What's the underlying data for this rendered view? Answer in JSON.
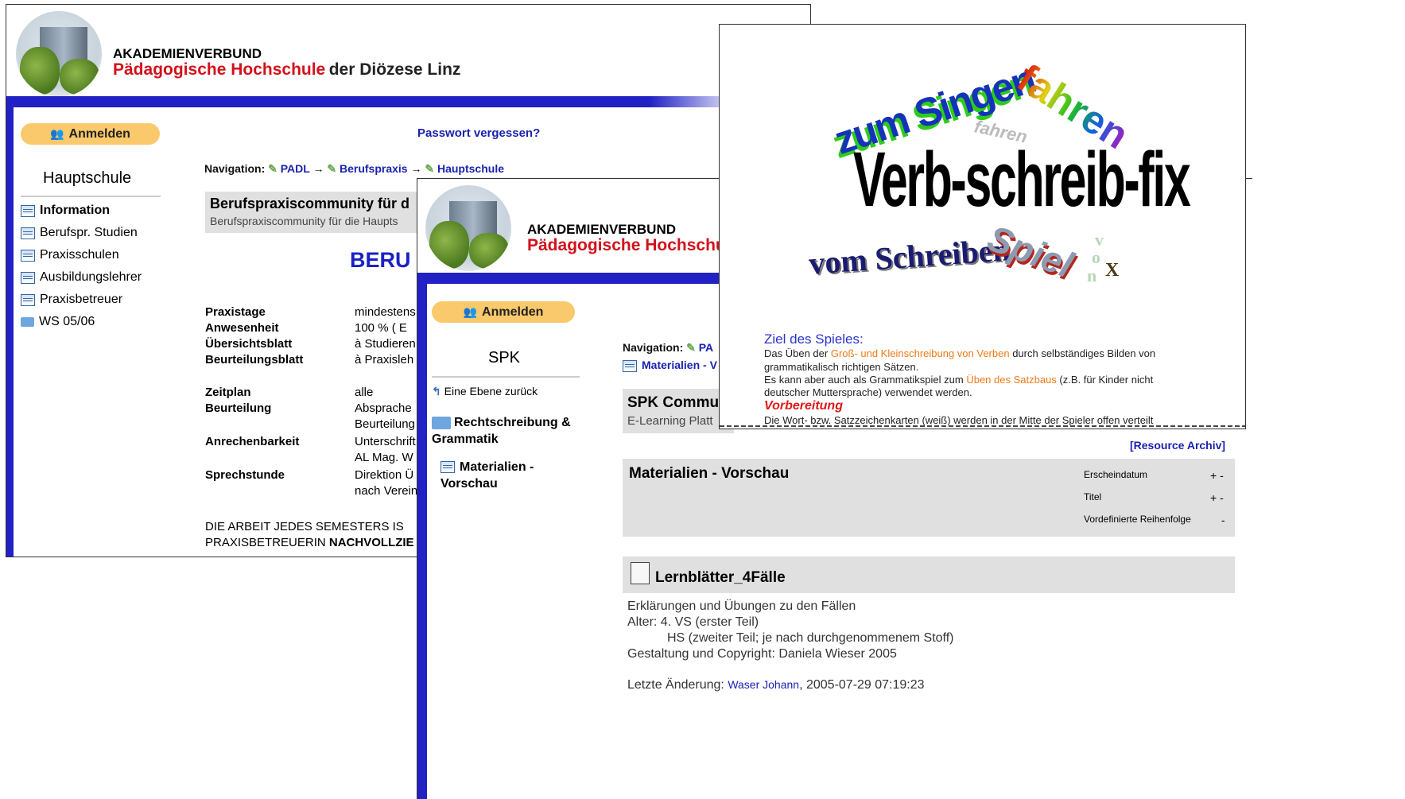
{
  "window1": {
    "banner": {
      "line1": "AKADEMIENVERBUND",
      "line2_red": "Pädagogische Hochschule",
      "line2_dark": "der Diözese Linz"
    },
    "login_label": "Anmelden",
    "forgot_password": "Passwort vergessen?",
    "sidebar_title": "Hauptschule",
    "sidebar_items": [
      "Information",
      "Berufspr. Studien",
      "Praxisschulen",
      "Ausbildungslehrer",
      "Praxisbetreuer",
      "WS 05/06"
    ],
    "nav_label": "Navigation:",
    "breadcrumb": [
      "PADL",
      "Berufspraxis",
      "Hauptschule"
    ],
    "breadcrumb_sep": "→",
    "section_title": "Berufspraxiscommunity für d",
    "section_subtitle": "Berufspraxiscommunity für die Haupts",
    "big_heading": "BERU",
    "details": [
      {
        "label": "Praxistage",
        "value": "mindestens"
      },
      {
        "label": "Anwesenheit",
        "value": "100 %   ( E"
      },
      {
        "label": "Übersichtsblatt",
        "value": "à Studieren"
      },
      {
        "label": "Beurteilungsblatt",
        "value": "à Praxisleh"
      },
      {
        "label": "Zeitplan",
        "value": "alle"
      },
      {
        "label": "Beurteilung",
        "value": "Absprache"
      },
      {
        "label": "",
        "value": "Beurteilung"
      },
      {
        "label": "Anrechenbarkeit",
        "value": "Unterschrift"
      },
      {
        "label": "",
        "value": "AL Mag. W"
      },
      {
        "label": "Sprechstunde",
        "value": "Direktion Ü"
      },
      {
        "label": "",
        "value": "nach Verein"
      }
    ],
    "footer_line1": "DIE ARBEIT JEDES SEMESTERS  IS",
    "footer_line2a": "PRAXISBETREUERIN ",
    "footer_line2b": "NACHVOLLZIE"
  },
  "window2": {
    "banner": {
      "line1": "AKADEMIENVERBUND",
      "line2_red": "Pädagogische Hochschu"
    },
    "login_label": "Anmelden",
    "sidebar_title": "SPK",
    "back_link": "Eine Ebene zurück",
    "folder_item": "Rechtschreibung & Grammatik",
    "sub_item": "Materialien - Vorschau",
    "nav_label": "Navigation:",
    "nav_link": "PA",
    "nav_link2": "Materialien - V",
    "section_title": "SPK Commu",
    "section_subtitle": "E-Learning Platt",
    "resource_archive": "[Resource Archiv]",
    "list_title": "Materialien - Vorschau",
    "sort_options": [
      {
        "label": "Erscheindatum",
        "controls": "+ -"
      },
      {
        "label": "Titel",
        "controls": "+ -"
      },
      {
        "label": "Vordefinierte Reihenfolge",
        "controls": "-"
      }
    ],
    "item_title": "Lernblätter_4Fälle",
    "item_lines": [
      "Erklärungen und Übungen zu den Fällen",
      "Alter: 4. VS (erster Teil)",
      "HS (zweiter Teil; je nach durchgenommenem Stoff)",
      "Gestaltung und Copyright: Daniela Wieser 2005"
    ],
    "last_change_label": "Letzte Änderung:",
    "last_change_user": "Waser Johann",
    "last_change_date": ", 2005-07-29 07:19:23"
  },
  "window3": {
    "wordart": {
      "w1": "zum Singen",
      "w2": "fahren",
      "w3": "fahren",
      "w4": "Verb-schreib-fix",
      "w5": "vom Schreiben",
      "w6": "Spiel",
      "w7": "v",
      "w8": "o",
      "w9": "n",
      "w10": "X"
    },
    "goal_heading": "Ziel des Spieles:",
    "goal_text_1a": "Das Üben der ",
    "goal_text_1b": "Groß- und Kleinschreibung von Verben",
    "goal_text_1c": " durch selbständiges Bilden von",
    "goal_text_2": "grammatikalisch richtigen Sätzen.",
    "goal_text_3a": "Es kann aber auch als Grammatikspiel zum ",
    "goal_text_3b": "Üben des Satzbaus",
    "goal_text_3c": " (z.B. für Kinder nicht",
    "goal_text_4": "deutscher Muttersprache) verwendet werden.",
    "prep_heading": "Vorbereitung",
    "prep_text": "Die Wort- bzw. Satzzeichenkarten (weiß) werden in der Mitte der Spieler offen verteilt"
  },
  "colors": {
    "accent_blue": "#2121c4",
    "red": "#d3111b",
    "pill": "#f9c96c",
    "link": "#1a22b0",
    "orange": "#f07a18"
  }
}
